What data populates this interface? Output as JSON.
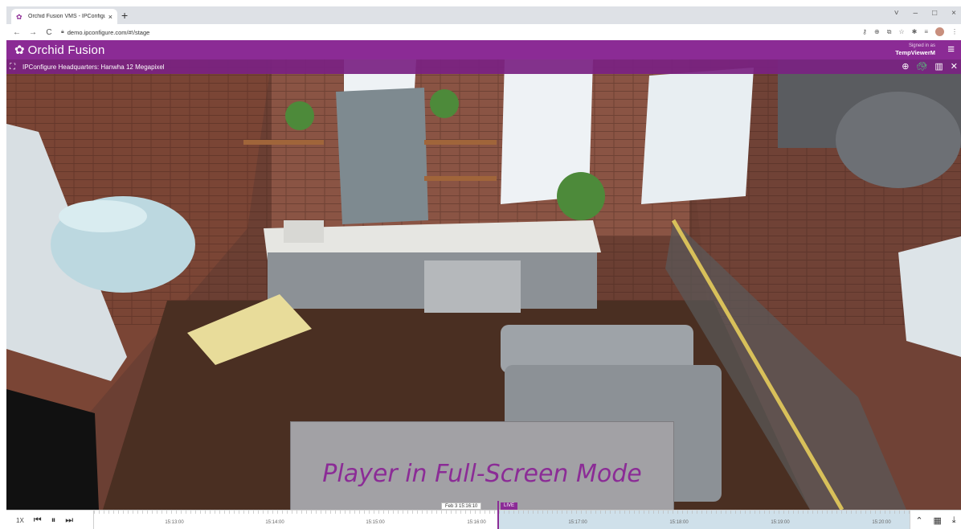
{
  "browser": {
    "tab_title": "Orchid Fusion VMS - IPConfigure",
    "tab_close": "×",
    "new_tab": "+",
    "url": "demo.ipconfigure.com/#!/stage",
    "nav": {
      "back": "←",
      "forward": "→",
      "reload": "C"
    },
    "window_controls": {
      "minimize": "–",
      "maximize": "□",
      "close": "×",
      "chevron": "˅"
    }
  },
  "app": {
    "name": "Orchid Fusion",
    "signed_in_label": "Signed in as",
    "username": "TempViewerM",
    "accent": "#8b2b95"
  },
  "player": {
    "camera_title": "IPConfigure Headquarters: Hanwha 12 Megapixel",
    "overlay_caption": "Player in Full-Screen Mode",
    "icons": [
      "grid-icon",
      "globe-icon",
      "turtle-icon",
      "chart-icon",
      "close-icon"
    ]
  },
  "timeline": {
    "speed": "1X",
    "current_timestamp": "Feb 3 15:16:10",
    "live_badge": "LIVE",
    "progress_fraction_past": 0.494,
    "labels": [
      "15:13:00",
      "15:14:00",
      "15:15:00",
      "15:16:00",
      "15:17:00",
      "15:18:00",
      "15:19:00",
      "15:20:00"
    ]
  }
}
